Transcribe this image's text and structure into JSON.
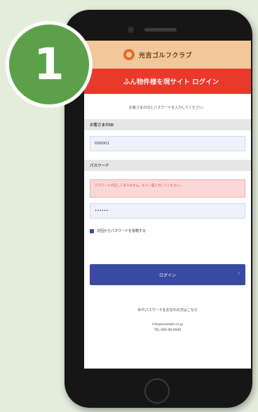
{
  "badge": {
    "number": "1"
  },
  "brand": {
    "name": "光吉ゴルフクラブ"
  },
  "screen": {
    "title": "ふん物件様を現サイト ログイン",
    "intro_text": "お客さまのIDとパスワードを入力してください。",
    "fields": {
      "id_label": "お客さまのID",
      "id_value": "000001",
      "password_label": "パスワード",
      "password_value": "••••••"
    },
    "error_message": "パスワードが正しくありません。もう一度入力してください。",
    "remember_label": "次回からパスワードを省略する",
    "login_button": "ログイン",
    "login_arrow": "›",
    "help_text": "IDやパスワードをお忘れの方はこちら",
    "contact_email": "info@example.co.jp",
    "contact_phone": "TEL 000-00-0000"
  },
  "colors": {
    "background": "#e4eddc",
    "badge": "#5ca14a",
    "brand_bar": "#f2c79a",
    "title_bar": "#e8392b",
    "button": "#3a4aa3"
  }
}
